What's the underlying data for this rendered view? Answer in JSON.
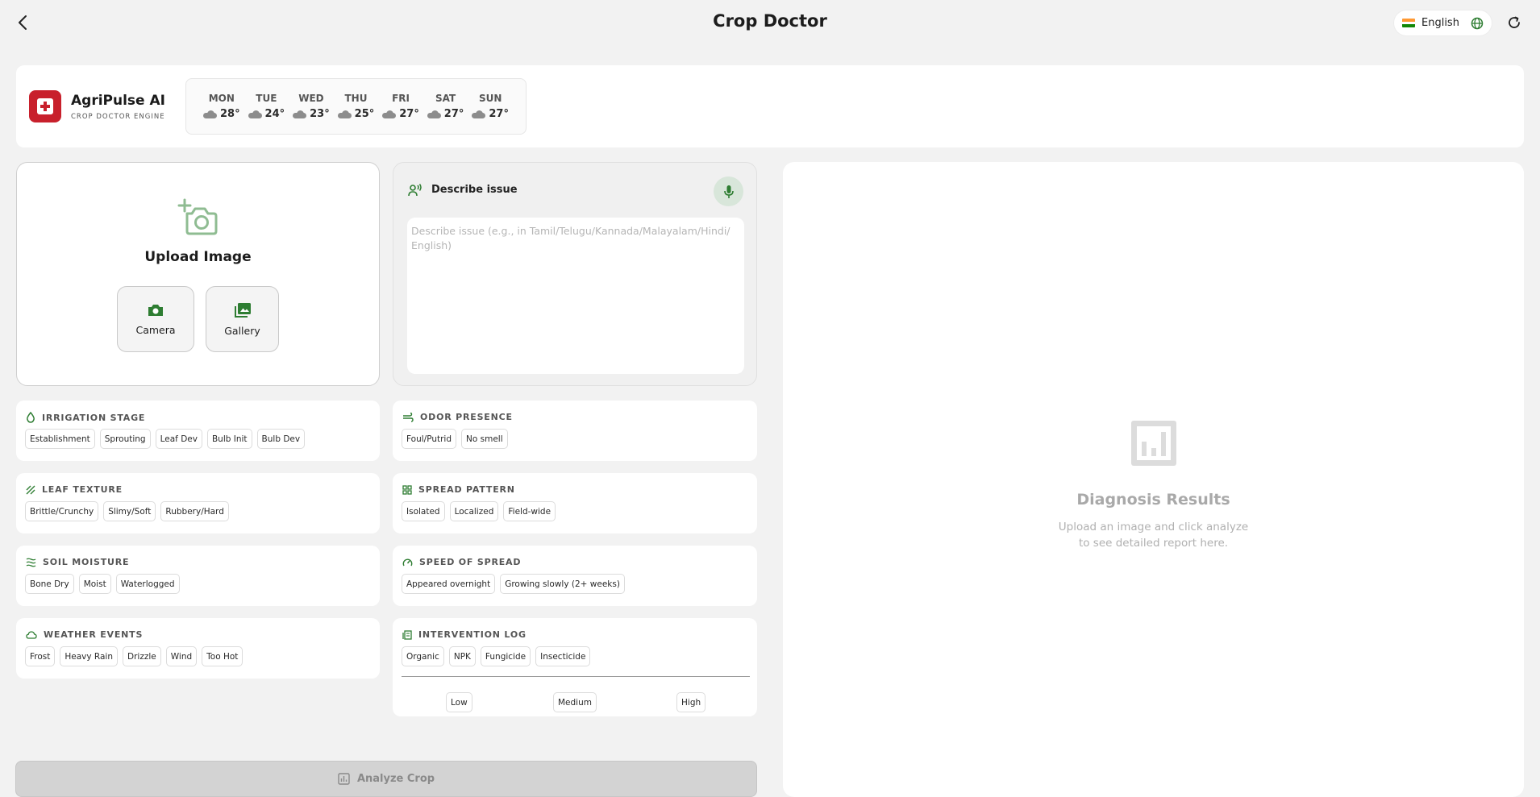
{
  "header": {
    "title": "Crop Doctor",
    "language": "English"
  },
  "brand": {
    "name": "AgriPulse AI",
    "subtitle": "CROP DOCTOR ENGINE"
  },
  "weather": [
    {
      "day": "MON",
      "temp": "28°"
    },
    {
      "day": "TUE",
      "temp": "24°"
    },
    {
      "day": "WED",
      "temp": "23°"
    },
    {
      "day": "THU",
      "temp": "25°"
    },
    {
      "day": "FRI",
      "temp": "27°"
    },
    {
      "day": "SAT",
      "temp": "27°"
    },
    {
      "day": "SUN",
      "temp": "27°"
    }
  ],
  "upload": {
    "title": "Upload Image",
    "camera_label": "Camera",
    "gallery_label": "Gallery"
  },
  "describe": {
    "title": "Describe issue",
    "value": "",
    "placeholder": "Describe issue (e.g., in Tamil/Telugu/Kannada/Malayalam/Hindi/ English)"
  },
  "options": {
    "irrigation_stage": {
      "title": "IRRIGATION STAGE",
      "chips": [
        "Establishment",
        "Sprouting",
        "Leaf Dev",
        "Bulb Init",
        "Bulb Dev"
      ]
    },
    "odor_presence": {
      "title": "ODOR PRESENCE",
      "chips": [
        "Foul/Putrid",
        "No smell"
      ]
    },
    "leaf_texture": {
      "title": "LEAF TEXTURE",
      "chips": [
        "Brittle/Crunchy",
        "Slimy/Soft",
        "Rubbery/Hard"
      ]
    },
    "spread_pattern": {
      "title": "SPREAD PATTERN",
      "chips": [
        "Isolated",
        "Localized",
        "Field-wide"
      ]
    },
    "soil_moisture": {
      "title": "SOIL MOISTURE",
      "chips": [
        "Bone Dry",
        "Moist",
        "Waterlogged"
      ]
    },
    "speed_of_spread": {
      "title": "SPEED OF SPREAD",
      "chips": [
        "Appeared overnight",
        "Growing slowly (2+ weeks)"
      ]
    },
    "weather_events": {
      "title": "WEATHER EVENTS",
      "chips": [
        "Frost",
        "Heavy Rain",
        "Drizzle",
        "Wind",
        "Too Hot"
      ]
    },
    "intervention_log": {
      "title": "INTERVENTION LOG",
      "chips": [
        "Organic",
        "NPK",
        "Fungicide",
        "Insecticide"
      ],
      "levels": [
        "Low",
        "Medium",
        "High"
      ]
    }
  },
  "analyze": {
    "label": "Analyze Crop"
  },
  "results": {
    "title": "Diagnosis Results",
    "subtitle_line1": "Upload an image and click analyze",
    "subtitle_line2": "to see detailed report here."
  },
  "colors": {
    "accent_green": "#2e7d32",
    "brand_red": "#c8202c",
    "flag": [
      "#ff9933",
      "#ffffff",
      "#138808"
    ]
  }
}
